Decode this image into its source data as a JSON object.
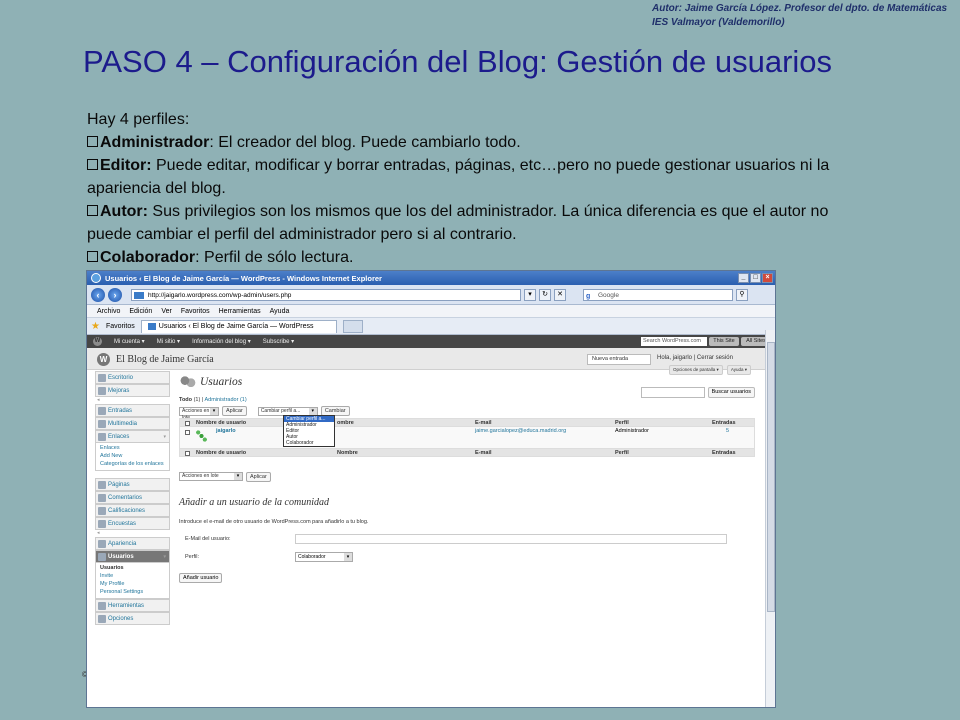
{
  "author": {
    "line1": "Autor: Jaime García López. Profesor del dpto. de Matemáticas",
    "line2": "IES Valmayor (Valdemorillo)"
  },
  "title": "PASO 4 – Configuración del Blog: Gestión de usuarios",
  "intro": "Hay 4 perfiles:",
  "profiles": [
    {
      "name": "Administrador",
      "sep": ":",
      "desc": " El creador del blog. Puede cambiarlo todo."
    },
    {
      "name": "Editor:",
      "sep": "",
      "desc": " Puede editar, modificar y borrar entradas, páginas, etc…pero no puede gestionar usuarios ni la apariencia del blog."
    },
    {
      "name": "Autor:",
      "sep": "",
      "desc": " Sus privilegios son los mismos que los del administrador. La única diferencia es que el autor no puede cambiar el perfil del administrador pero si al contrario."
    },
    {
      "name": "Colaborador",
      "sep": ":",
      "desc": " Perfil de sólo lectura."
    }
  ],
  "slide_number": "©",
  "browser": {
    "window_title": "Usuarios ‹ El Blog de Jaime García — WordPress - Windows Internet Explorer",
    "url": "http://jaigarlo.wordpress.com/wp-admin/users.php",
    "search_placeholder": "Google",
    "menu": [
      "Archivo",
      "Edición",
      "Ver",
      "Favoritos",
      "Herramientas",
      "Ayuda"
    ],
    "favorites_label": "Favoritos",
    "tab_label": "Usuarios ‹ El Blog de Jaime García — WordPress"
  },
  "wpbar": {
    "items": [
      "Mi cuenta ▾",
      "Mi sitio ▾",
      "Información del blog ▾",
      "Subscribe ▾"
    ],
    "search": "Search WordPress.com",
    "this_site": "This Site",
    "all_sites": "All Sites"
  },
  "wphead": {
    "blog_title": "El Blog de Jaime García",
    "new_entry": "Nueva entrada",
    "greeting": "Hola, jaigarlo | Cerrar sesión"
  },
  "sidebar": {
    "items": [
      {
        "label": "Escritorio"
      },
      {
        "label": "Mejoras"
      },
      {
        "label": "Entradas"
      },
      {
        "label": "Multimedia"
      },
      {
        "label": "Enlaces"
      },
      {
        "label": "Páginas"
      },
      {
        "label": "Comentarios"
      },
      {
        "label": "Calificaciones"
      },
      {
        "label": "Encuestas"
      },
      {
        "label": "Apariencia"
      },
      {
        "label": "Usuarios"
      },
      {
        "label": "Herramientas"
      },
      {
        "label": "Opciones"
      }
    ],
    "enlaces_sub": [
      "Enlaces",
      "Add New",
      "Categorías de los enlaces"
    ],
    "usuarios_sub": [
      "Usuarios",
      "Invite",
      "My Profile",
      "Personal Settings"
    ]
  },
  "main": {
    "page_title": "Usuarios",
    "screen_options": "Opciones de pantalla ▾",
    "help": "Ayuda ▾",
    "search_button": "Buscar usuarios",
    "filter_all": "Todo",
    "filter_all_count": "(1)",
    "filter_admin": "Administrador (1)",
    "bulk_actions": "Acciones en lote",
    "apply": "Aplicar",
    "change_role": "Cambiar perfil a...",
    "change_button": "Cambiar",
    "role_options": [
      "Cambiar perfil a...",
      "Administrador",
      "Editor",
      "Autor",
      "Colaborador"
    ],
    "columns": {
      "username": "Nombre de usuario",
      "name": "Nombre",
      "email": "E-mail",
      "role": "Perfil",
      "posts": "Entradas"
    },
    "name_header_partial": "ombre",
    "row": {
      "username": "jaigarlo",
      "email": "jaime.garcialopez@educa.madrid.org",
      "role": "Administrador",
      "posts": "5"
    },
    "add_heading": "Añadir a un usuario de la comunidad",
    "add_intro": "Introduce el e-mail de otro usuario de WordPress.com para añadirlo a tu blog.",
    "email_label": "E-Mail del usuario:",
    "role_label": "Perfil:",
    "role_value": "Colaborador",
    "add_button": "Añadir usuario"
  }
}
